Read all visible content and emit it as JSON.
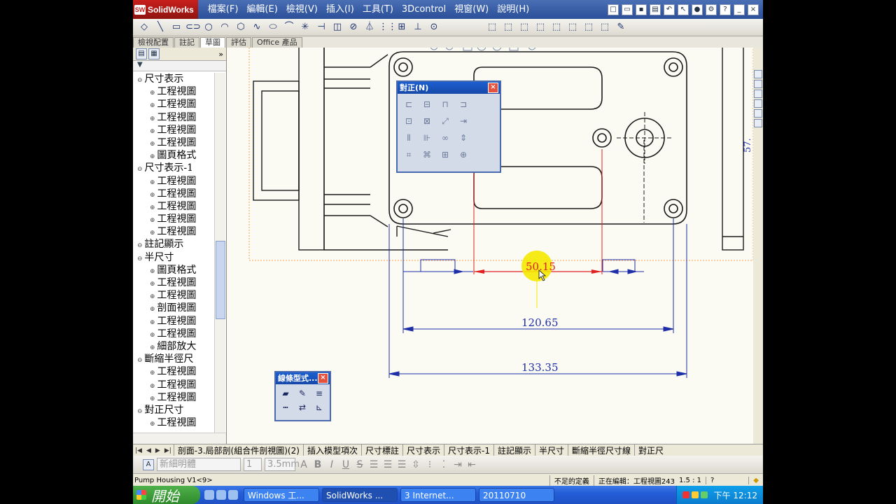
{
  "app": {
    "logo": "SolidWorks"
  },
  "menu": [
    "檔案(F)",
    "編輯(E)",
    "檢視(V)",
    "插入(I)",
    "工具(T)",
    "3Dcontrol",
    "視窗(W)",
    "說明(H)"
  ],
  "cmd_tabs": [
    {
      "label": "檢視配置",
      "active": false
    },
    {
      "label": "註記",
      "active": false
    },
    {
      "label": "草圖",
      "active": true
    },
    {
      "label": "評估",
      "active": false
    },
    {
      "label": "Office 產品",
      "active": false
    }
  ],
  "tree": [
    {
      "label": "尺寸表示",
      "level": 0
    },
    {
      "label": "工程視圖",
      "level": 1
    },
    {
      "label": "工程視圖",
      "level": 1
    },
    {
      "label": "工程視圖",
      "level": 1
    },
    {
      "label": "工程視圖",
      "level": 1
    },
    {
      "label": "工程視圖",
      "level": 1
    },
    {
      "label": "圖頁格式",
      "level": 1
    },
    {
      "label": "尺寸表示-1",
      "level": 0
    },
    {
      "label": "工程視圖",
      "level": 1
    },
    {
      "label": "工程視圖",
      "level": 1
    },
    {
      "label": "工程視圖",
      "level": 1
    },
    {
      "label": "工程視圖",
      "level": 1
    },
    {
      "label": "工程視圖",
      "level": 1
    },
    {
      "label": "註記顯示",
      "level": 0
    },
    {
      "label": "半尺寸",
      "level": 0
    },
    {
      "label": "圖頁格式",
      "level": 1
    },
    {
      "label": "工程視圖",
      "level": 1
    },
    {
      "label": "工程視圖",
      "level": 1
    },
    {
      "label": "剖面視圖",
      "level": 1
    },
    {
      "label": "工程視圖",
      "level": 1
    },
    {
      "label": "工程視圖",
      "level": 1
    },
    {
      "label": "細部放大",
      "level": 1
    },
    {
      "label": "斷縮半徑尺",
      "level": 0
    },
    {
      "label": "工程視圖",
      "level": 1
    },
    {
      "label": "工程視圖",
      "level": 1
    },
    {
      "label": "工程視圖",
      "level": 1
    },
    {
      "label": "對正尺寸",
      "level": 0
    },
    {
      "label": "工程視圖",
      "level": 1
    }
  ],
  "drawing": {
    "dims": {
      "d1": "50.15",
      "d2": "120.65",
      "d3": "133.35"
    },
    "side_dim": "57.",
    "colors": {
      "geometry": "#1a1a1a",
      "dimension": "#1d2ea8",
      "selected": "#e02020",
      "highlight": "#f5e800"
    }
  },
  "align_dialog": {
    "title": "對正(N)",
    "close": "×"
  },
  "line_dialog": {
    "title": "線條型式...",
    "close": "×"
  },
  "sheet_tabs": [
    "剖面-3.局部剖(組合件剖視圖)(2)",
    "插入模型項次",
    "尺寸標註",
    "尺寸表示",
    "尺寸表示-1",
    "註記顯示",
    "半尺寸",
    "斷縮半徑尺寸線",
    "對正尺"
  ],
  "format": {
    "font": "新細明體",
    "size": "1",
    "height": "3.5mm"
  },
  "status": {
    "doc": "Pump Housing V1<9>",
    "def": "不足的定義",
    "editing": "正在編輯：工程視圖243",
    "scale": "1.5 : 1",
    "help": "?"
  },
  "taskbar": {
    "start": "開始",
    "tasks": [
      {
        "label": "Windows 工...",
        "active": false
      },
      {
        "label": "SolidWorks ...",
        "active": true
      },
      {
        "label": "3 Internet...",
        "active": false
      },
      {
        "label": "20110710",
        "active": false
      }
    ],
    "time": "下午 12:12"
  }
}
